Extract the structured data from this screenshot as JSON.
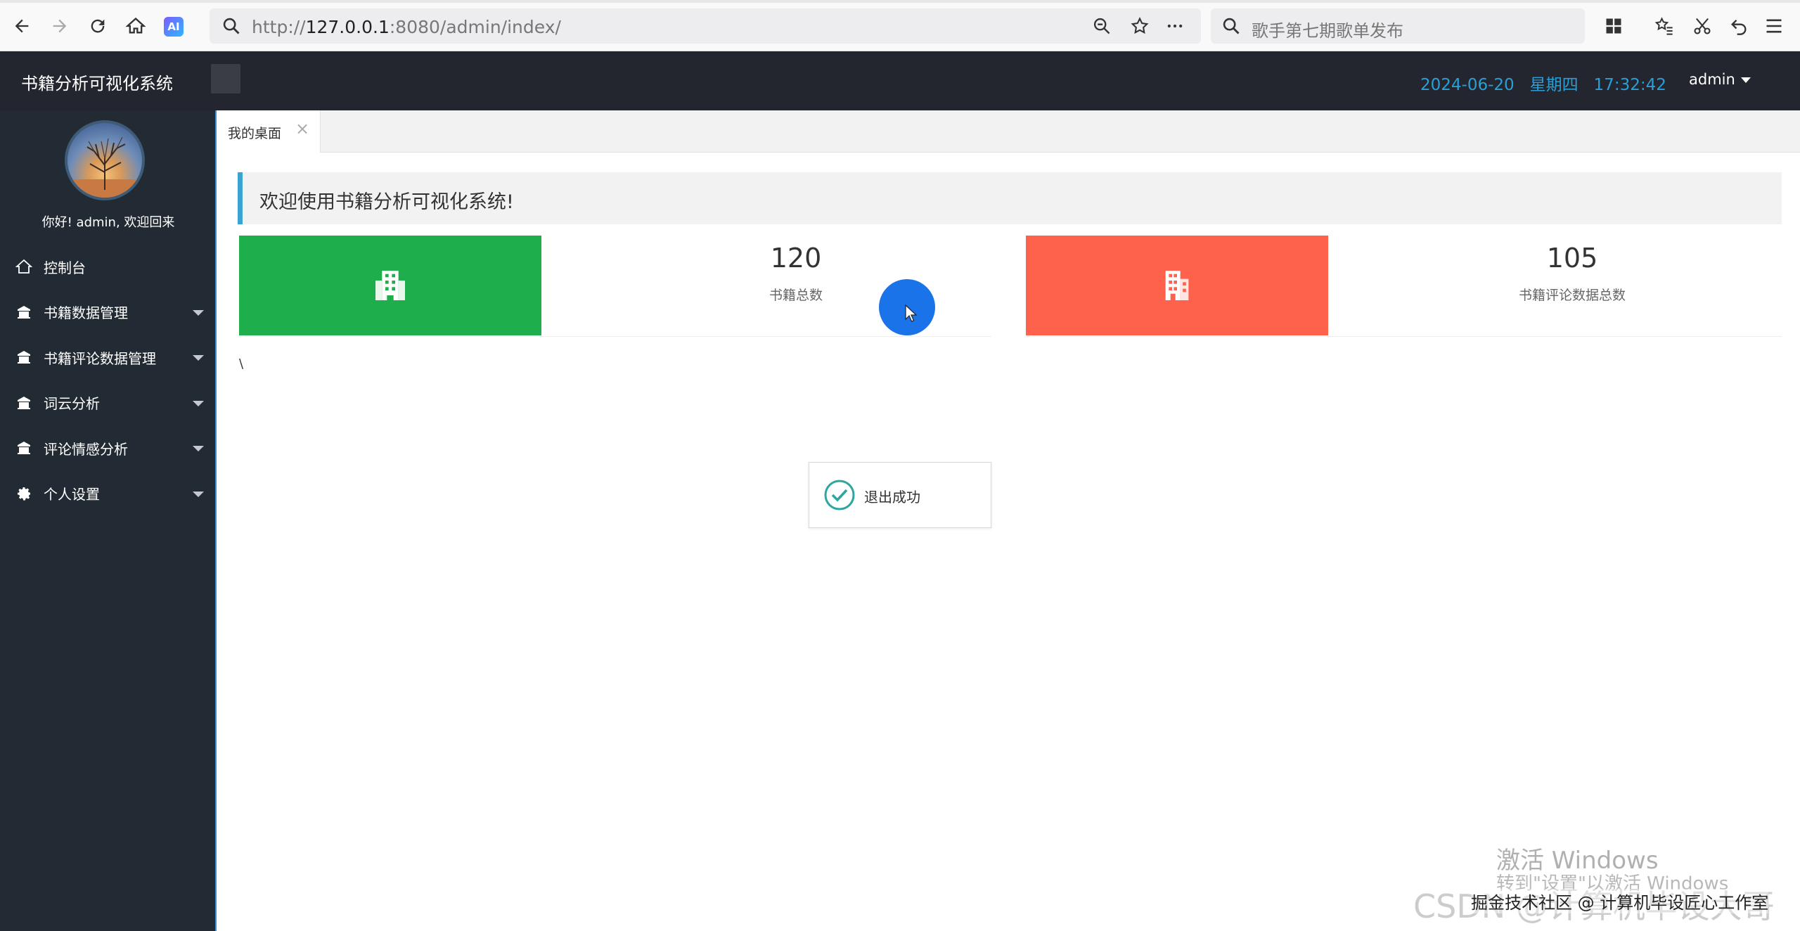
{
  "browser": {
    "url_prefix": "http://",
    "url_host": "127.0.0.1",
    "url_rest": ":8080/admin/index/",
    "search_placeholder": "歌手第七期歌单发布",
    "ai_label": "AI"
  },
  "header": {
    "title": "书籍分析可视化系统",
    "date": "2024-06-20",
    "weekday": "星期四",
    "time": "17:32:42",
    "user": "admin"
  },
  "sidebar": {
    "greeting": "你好!  admin, 欢迎回来",
    "items": [
      {
        "label": "控制台",
        "icon": "home-icon",
        "has_arrow": false
      },
      {
        "label": "书籍数据管理",
        "icon": "bank-icon",
        "has_arrow": true
      },
      {
        "label": "书籍评论数据管理",
        "icon": "bank-icon",
        "has_arrow": true
      },
      {
        "label": "词云分析",
        "icon": "bank-icon",
        "has_arrow": true
      },
      {
        "label": "评论情感分析",
        "icon": "bank-icon",
        "has_arrow": true
      },
      {
        "label": "个人设置",
        "icon": "gear-icon",
        "has_arrow": true
      }
    ]
  },
  "tabs": [
    {
      "label": "我的桌面",
      "close": "×"
    }
  ],
  "welcome": "欢迎使用书籍分析可视化系统!",
  "stats": [
    {
      "value": "120",
      "label": "书籍总数",
      "color": "#1fae4c",
      "icon": "building-icon"
    },
    {
      "value": "105",
      "label": "书籍评论数据总数",
      "color": "#fe614c",
      "icon": "office-building-icon"
    }
  ],
  "stray_text": "\\",
  "toast": {
    "message": "退出成功",
    "icon": "check-circle-icon"
  },
  "overlay": {
    "windows_activation_1": "激活 Windows",
    "windows_activation_2": "转到\"设置\"以激活 Windows",
    "csdn_watermark": "CSDN @计算机毕设大哥",
    "juejin_watermark": "掘金技术社区 @ 计算机毕设匠心工作室"
  },
  "colors": {
    "header_bg": "#23262e",
    "sidebar_bg": "#222b33",
    "date_color": "#2a9fd6",
    "welcome_accent": "#3ba3d0"
  }
}
